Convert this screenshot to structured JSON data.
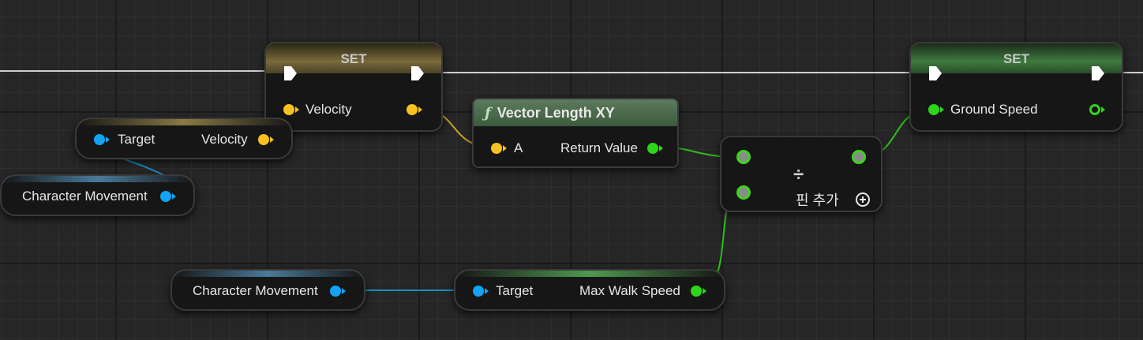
{
  "nodes": {
    "set_velocity": {
      "title": "SET",
      "pin_label": "Velocity"
    },
    "get_velocity": {
      "target_label": "Target",
      "output_label": "Velocity"
    },
    "char_movement_1": {
      "label": "Character Movement"
    },
    "vector_length": {
      "func_symbol": "ƒ",
      "title": "Vector Length XY",
      "input_label": "A",
      "output_label": "Return Value"
    },
    "divide": {
      "symbol": "÷",
      "add_pin_label": "핀 추가"
    },
    "set_ground_speed": {
      "title": "SET",
      "pin_label": "Ground Speed"
    },
    "char_movement_2": {
      "label": "Character Movement"
    },
    "max_walk_speed": {
      "target_label": "Target",
      "output_label": "Max Walk Speed"
    }
  },
  "colors": {
    "vector_pin": "#f7c21f",
    "object_pin": "#12a4f2",
    "float_pin": "#2fd51a",
    "exec_wire": "#d0d0d0"
  }
}
